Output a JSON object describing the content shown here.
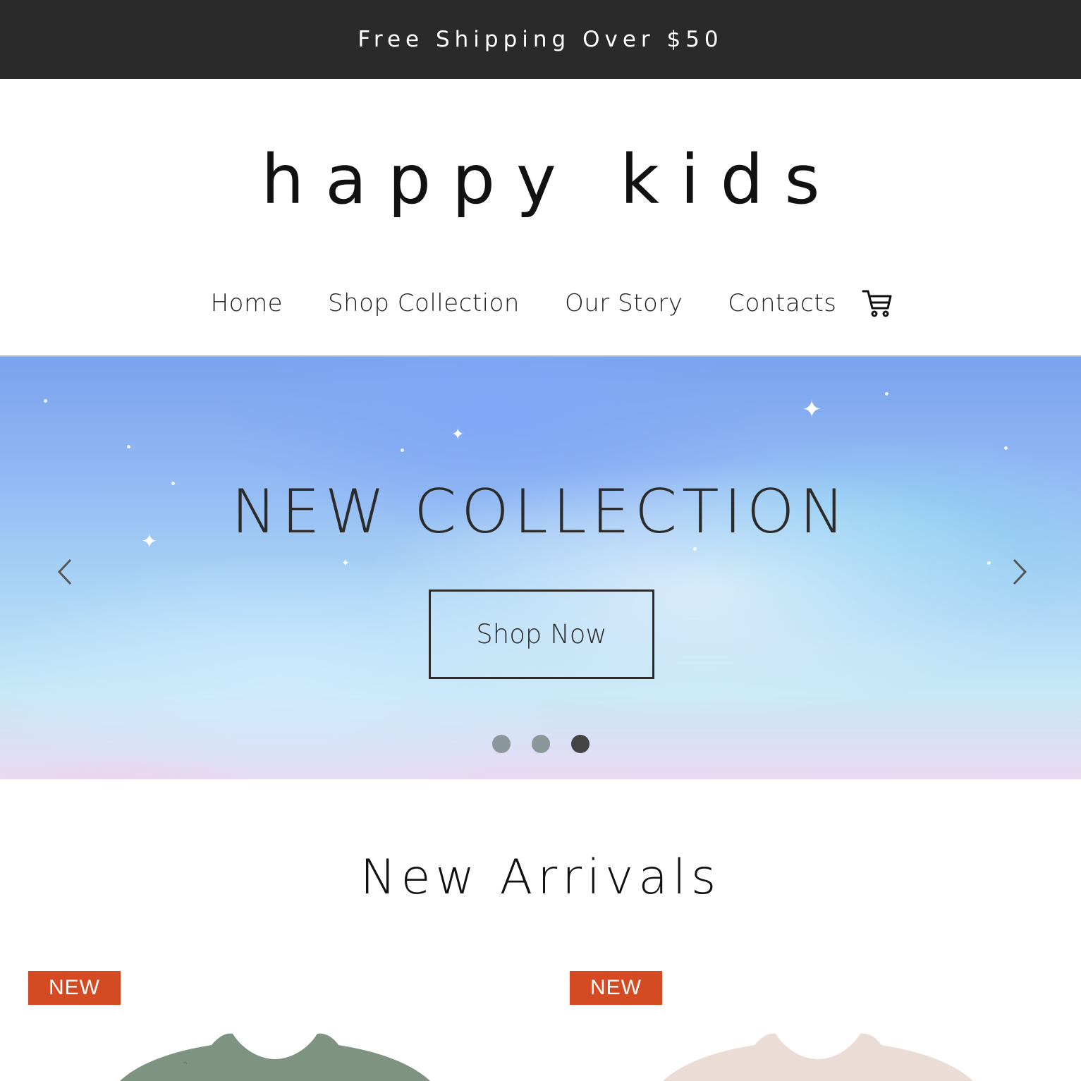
{
  "announcement": {
    "text": "Free Shipping Over $50"
  },
  "brand": {
    "logo": "happy kids"
  },
  "nav": {
    "items": [
      {
        "label": "Home"
      },
      {
        "label": "Shop Collection"
      },
      {
        "label": "Our Story"
      },
      {
        "label": "Contacts"
      }
    ],
    "cart_icon": "cart-icon"
  },
  "hero": {
    "title": "NEW COLLECTION",
    "button_label": "Shop Now",
    "prev_icon": "chevron-left-icon",
    "next_icon": "chevron-right-icon",
    "slides": 3,
    "active_slide": 3
  },
  "new_arrivals": {
    "title": "New Arrivals",
    "products": [
      {
        "badge": "NEW",
        "color": "#7f9382"
      },
      {
        "badge": "NEW",
        "color": "#e9ddd6"
      }
    ]
  },
  "colors": {
    "announcement_bg": "#2a2a2a",
    "badge_bg": "#d44a22",
    "text": "#222222"
  }
}
